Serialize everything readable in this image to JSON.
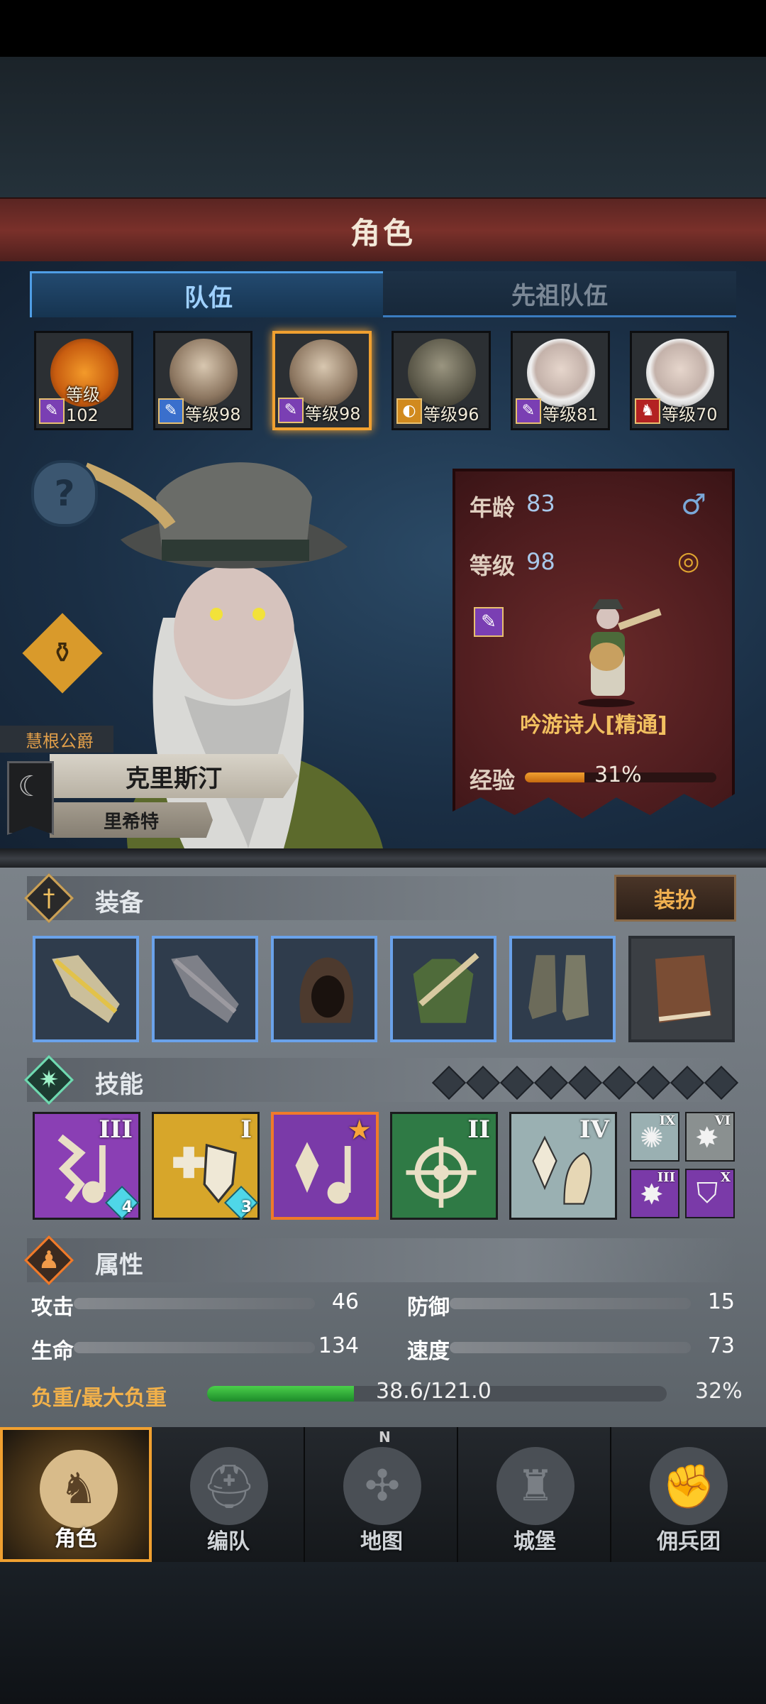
{
  "header": {
    "title": "角色"
  },
  "tabs": [
    {
      "label": "队伍",
      "active": true
    },
    {
      "label": "先祖队伍",
      "active": false
    }
  ],
  "roster": [
    {
      "level": "等级102",
      "class_icon": "staff-icon",
      "badge_color": "#7a3fb3"
    },
    {
      "level": "等级98",
      "class_icon": "sword-icon",
      "badge_color": "#3a6fcc"
    },
    {
      "level": "等级98",
      "class_icon": "staff-icon",
      "badge_color": "#7a3fb3",
      "selected": true
    },
    {
      "level": "等级96",
      "class_icon": "shield-icon",
      "badge_color": "#d18a1e"
    },
    {
      "level": "等级81",
      "class_icon": "staff-icon",
      "badge_color": "#7a3fb3"
    },
    {
      "level": "等级70",
      "class_icon": "beast-icon",
      "badge_color": "#b32222"
    }
  ],
  "character": {
    "title": "慧根公爵",
    "name": "克里斯汀",
    "origin": "里希特",
    "help_glyph": "?",
    "potion_glyph": "⚱"
  },
  "info": {
    "age_label": "年龄",
    "age": "83",
    "sex_icon": "♂",
    "level_label": "等级",
    "level": "98",
    "ring_icon": "◎",
    "class_name": "吟游诗人[精通]",
    "exp_label": "经验",
    "exp_percent": "31%",
    "exp_fraction": 0.31
  },
  "equipment": {
    "title": "装备",
    "dress_button": "装扮",
    "slots": [
      "weapon-main",
      "weapon-off",
      "hood",
      "armor",
      "boots",
      "book"
    ]
  },
  "skills": {
    "title": "技能",
    "main": [
      {
        "numeral": "III",
        "gem": "4",
        "bg": "#8a3fb4",
        "icon": "music-note-icon"
      },
      {
        "numeral": "I",
        "gem": "3",
        "bg": "#d7a62a",
        "icon": "shield-heal-icon"
      },
      {
        "numeral": "",
        "gem": "",
        "bg": "#7a3aa8",
        "icon": "crystal-note-icon",
        "selected": true
      },
      {
        "numeral": "II",
        "gem": "",
        "bg": "#2f7a45",
        "icon": "target-icon"
      },
      {
        "numeral": "IV",
        "gem": "",
        "bg": "#9ab0b2",
        "icon": "crystal-arm-icon"
      }
    ],
    "mini": [
      {
        "numeral": "IX",
        "bg": "#9ab0b2"
      },
      {
        "numeral": "VI",
        "bg": "#8a9090"
      },
      {
        "numeral": "III",
        "bg": "#7a3aa8"
      },
      {
        "numeral": "X",
        "bg": "#7a3aa8"
      }
    ],
    "slots_indicator_count": 9
  },
  "attributes": {
    "title": "属性",
    "attack_label": "攻击",
    "attack": "46",
    "defense_label": "防御",
    "defense": "15",
    "hp_label": "生命",
    "hp": "134",
    "speed_label": "速度",
    "speed": "73",
    "load_label": "负重/最大负重",
    "load_value": "38.6/121.0",
    "load_percent": "32%",
    "load_fraction": 0.32
  },
  "nav": [
    {
      "label": "角色",
      "icon": "knight-icon",
      "selected": true
    },
    {
      "label": "编队",
      "icon": "helmet-icon"
    },
    {
      "label": "地图",
      "icon": "compass-icon",
      "compass_letter": "N"
    },
    {
      "label": "城堡",
      "icon": "castle-icon"
    },
    {
      "label": "佣兵团",
      "icon": "fist-icon"
    }
  ]
}
